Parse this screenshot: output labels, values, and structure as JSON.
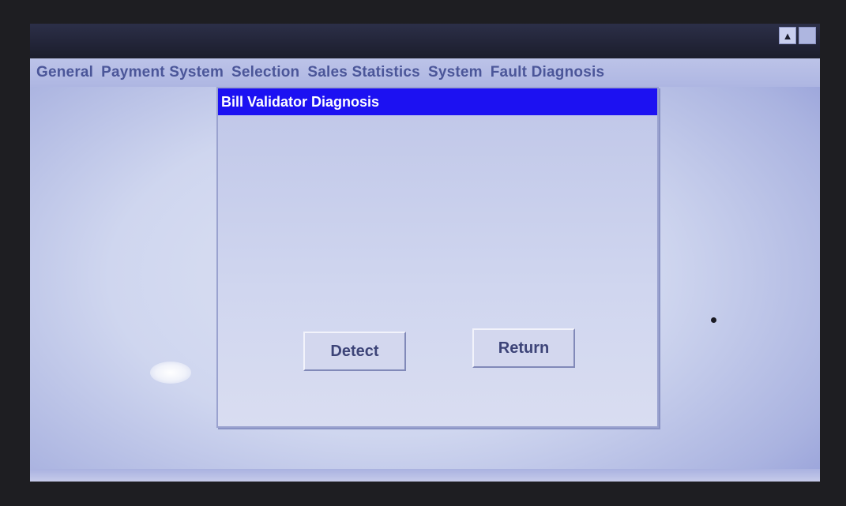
{
  "window": {
    "scroll_up_glyph": "▲"
  },
  "menu": {
    "items": [
      "General",
      "Payment System",
      "Selection",
      "Sales Statistics",
      "System",
      "Fault Diagnosis"
    ]
  },
  "dialog": {
    "title": "Bill Validator Diagnosis",
    "detect_label": "Detect",
    "return_label": "Return"
  },
  "colors": {
    "dialog_title_bar": "#1c11f2",
    "menu_text": "#4b5699",
    "screen_background": "#cfd6ef"
  }
}
